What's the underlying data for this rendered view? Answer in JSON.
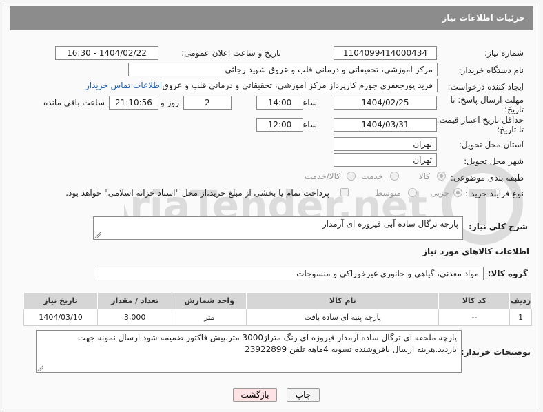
{
  "header": {
    "title": "جزئیات اطلاعات نیاز"
  },
  "form": {
    "need_number": {
      "label": "شماره نیاز:",
      "value": "1104099414000434"
    },
    "announce": {
      "label": "تاریخ و ساعت اعلان عمومی:",
      "value": "1404/02/22 - 16:30"
    },
    "buyer": {
      "label": "نام دستگاه خریدار:",
      "value": "مرکز آموزشی، تحقیقاتی و درمانی قلب و عروق شهید رجائی"
    },
    "creator": {
      "label": "ایجاد کننده درخواست:",
      "value": "فرید پورجعفری جوزم کارپرداز  مرکز آموزشی، تحقیقاتی و درمانی قلب و عروق شهید رجائی",
      "contact_link": "اطلاعات تماس خریدار"
    },
    "deadline": {
      "label_line1": "مهلت ارسال پاسخ: تا",
      "label_line2": "تاریخ:",
      "date": "1404/02/25",
      "time_label": "ساعت",
      "time": "14:00",
      "days": "2",
      "days_label": "روز و",
      "remaining": "21:10:56",
      "remaining_label": "ساعت باقی مانده"
    },
    "validity": {
      "label_line1": "حداقل تاریخ اعتبار قیمت:",
      "label_line2": "تا تاریخ:",
      "date": "1404/03/31",
      "time_label": "ساعت",
      "time": "12:00"
    },
    "province": {
      "label": "استان محل تحویل:",
      "value": "تهران"
    },
    "city": {
      "label": "شهر محل تحویل:",
      "value": "تهران"
    },
    "category": {
      "label": "طبقه بندی موضوعی:",
      "options": [
        "کالا",
        "خدمت",
        "کالا/خدمت"
      ],
      "selected": "کالا"
    },
    "purchase_type": {
      "label": "نوع فرآیند خرید :",
      "options": [
        "جزیی",
        "متوسط"
      ],
      "payment_note": "پرداخت تمام یا بخشی از مبلغ خرید،از محل \"اسناد خزانه اسلامی\" خواهد بود."
    }
  },
  "summary": {
    "label": "شرح کلی نیاز:",
    "value": "پارچه ترگال ساده آبی فیروزه ای آرمدار"
  },
  "goods_section": {
    "title": "اطلاعات کالاهای مورد نیاز",
    "group_label": "گروه کالا:",
    "group_value": "مواد معدنی، گیاهی و جانوری غیرخوراکی و منسوجات"
  },
  "table": {
    "headers": [
      "ردیف",
      "کد کالا",
      "نام کالا",
      "واحد شمارش",
      "تعداد / مقدار",
      "تاریخ نیاز"
    ],
    "rows": [
      [
        "1",
        "--",
        "پارچه پنبه ای ساده بافت",
        "متر",
        "3,000",
        "1404/03/10"
      ]
    ]
  },
  "buyer_notes": {
    "label": "توضیحات خریدار:",
    "value": "پارچه ملحفه ای ترگال ساده آرمدار فیروزه ای رنگ متراژ3000 متر.پیش فاکتور ضمیمه شود ارسال نمونه جهت بازدید.هزینه ارسال بافروشنده تسویه 4ماهه تلفن 23922899"
  },
  "buttons": {
    "print": "چاپ",
    "back": "بازگشت"
  },
  "watermark": {
    "text": "AriaTender.net"
  },
  "colors": {
    "header_bg": "#8c8c8c",
    "link": "#1a5fb4",
    "back_button": "#fde3e3"
  }
}
